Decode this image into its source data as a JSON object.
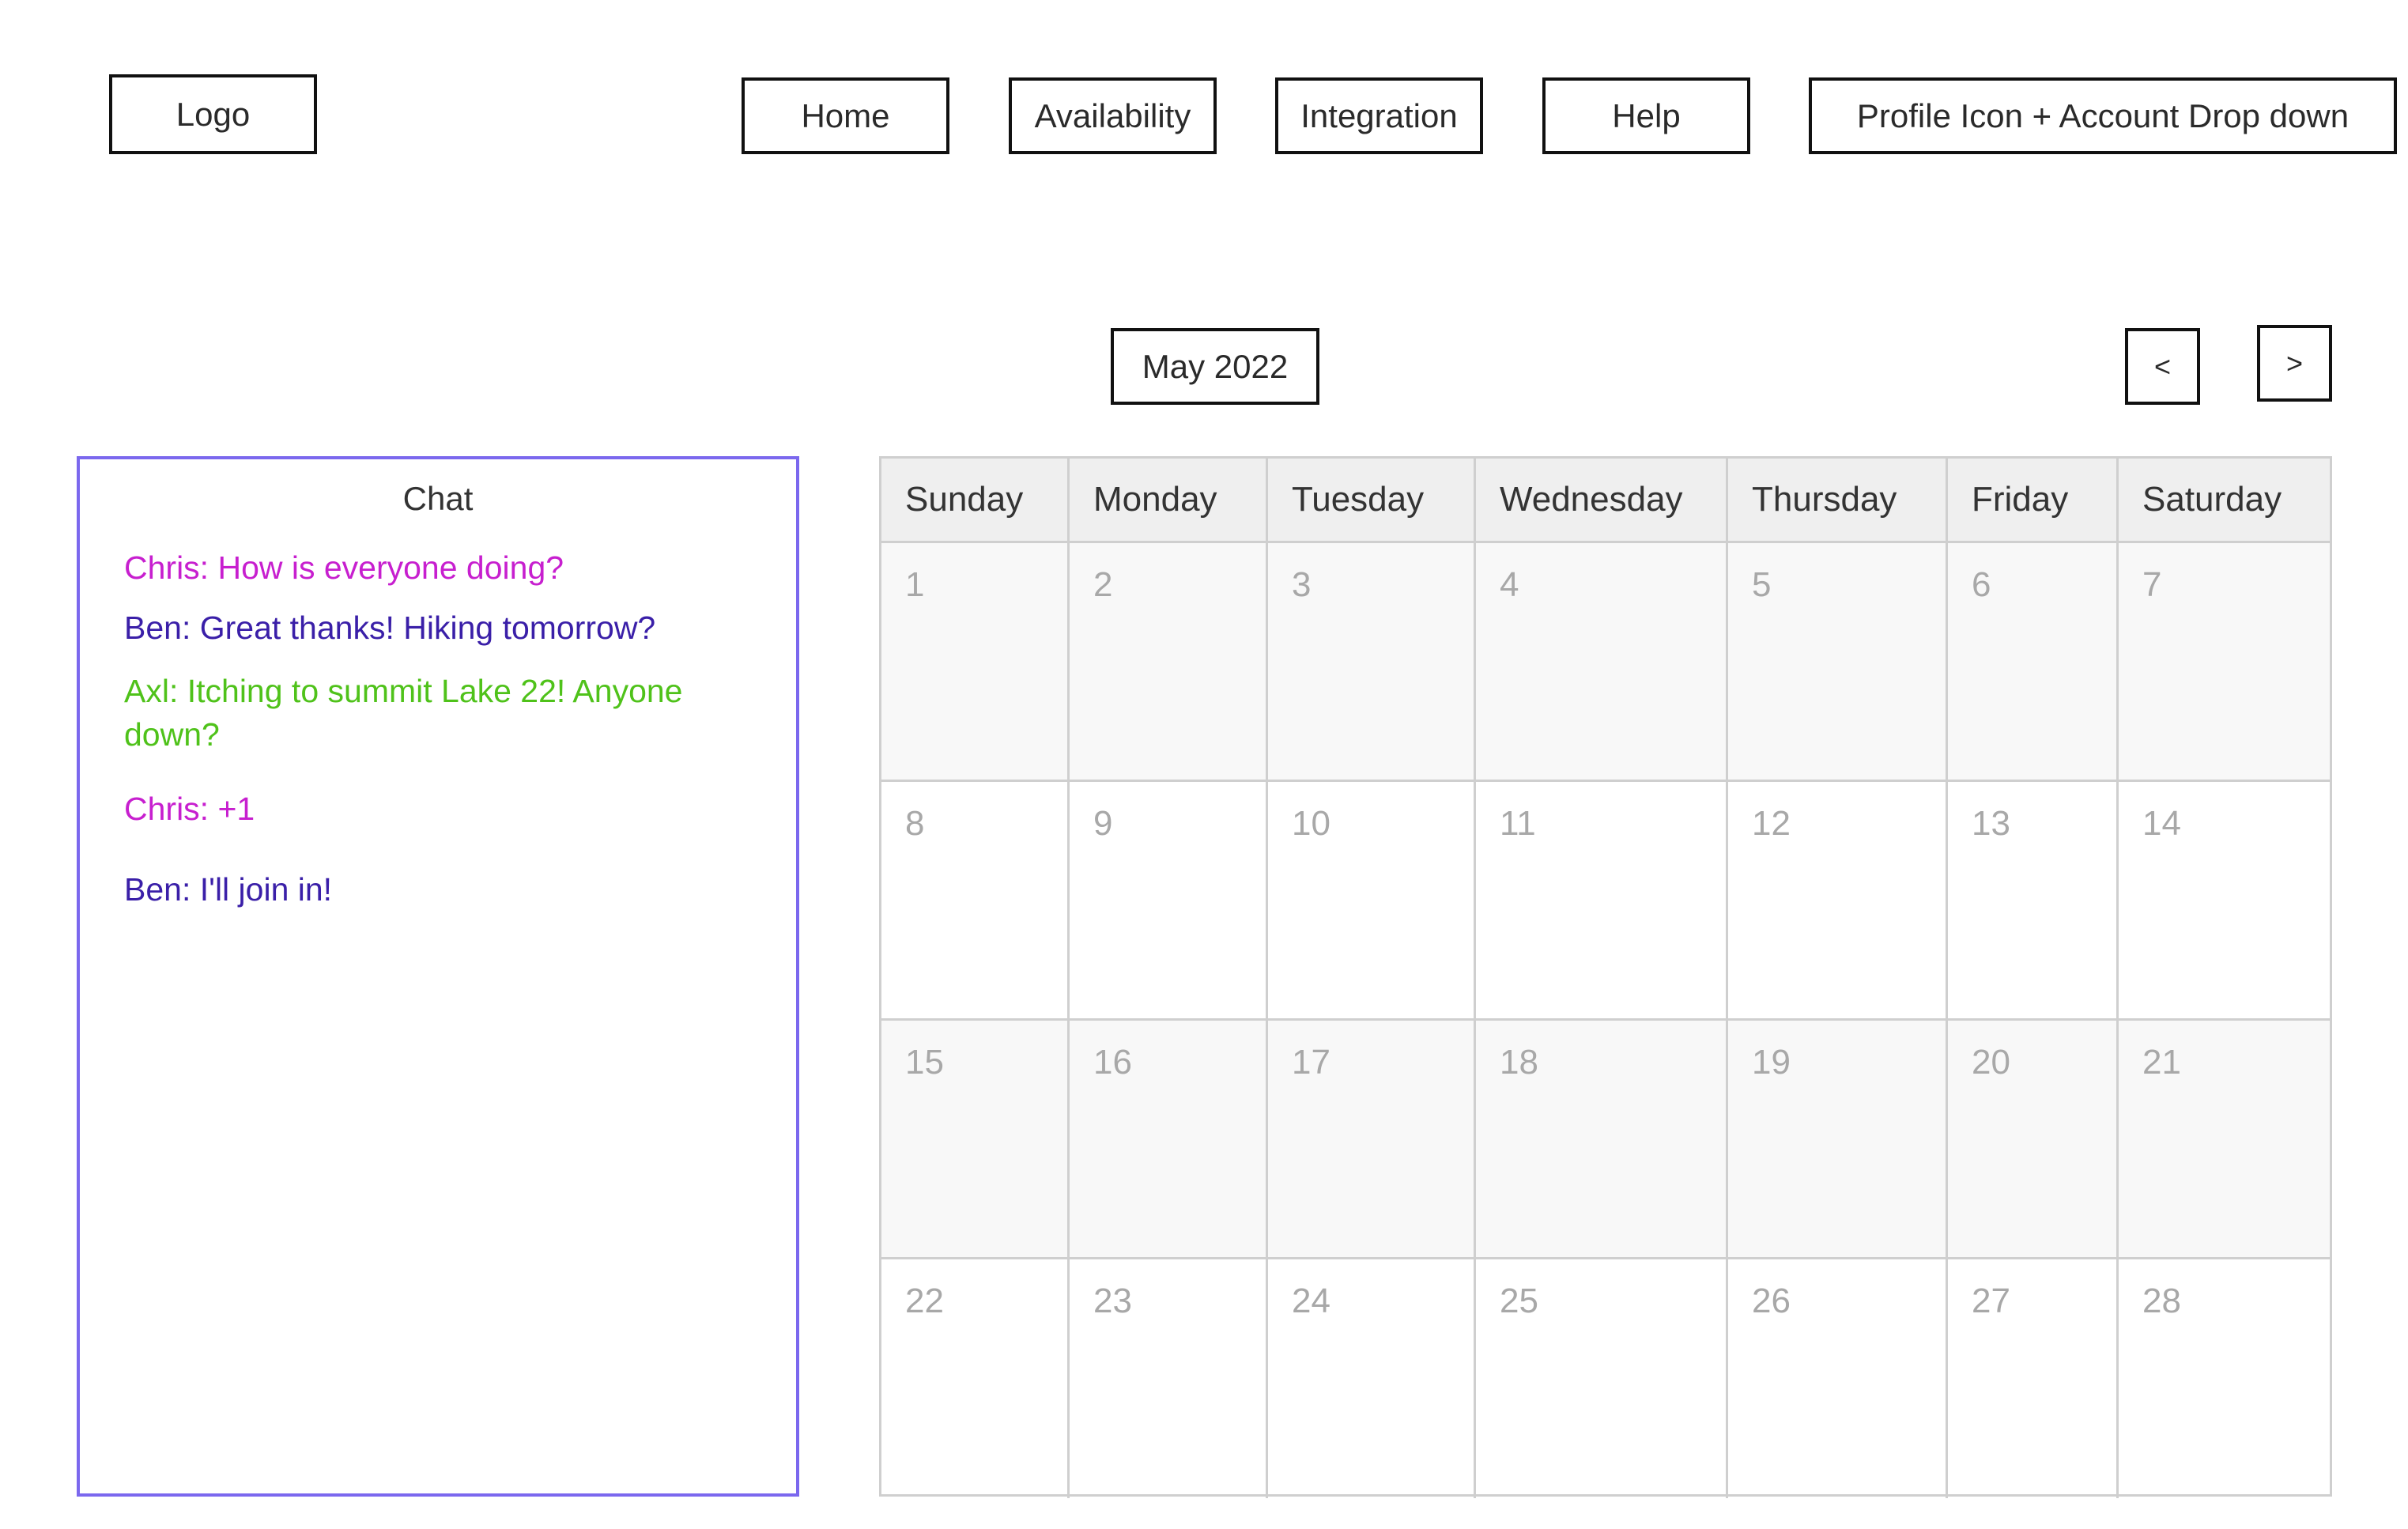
{
  "header": {
    "logo_label": "Logo",
    "nav": {
      "home": "Home",
      "availability": "Availability",
      "integration": "Integration",
      "help": "Help",
      "profile": "Profile Icon + Account Drop down"
    }
  },
  "calendar": {
    "month_label": "May 2022",
    "prev_label": "<",
    "next_label": ">",
    "days": [
      "Sunday",
      "Monday",
      "Tuesday",
      "Wednesday",
      "Thursday",
      "Friday",
      "Saturday"
    ],
    "weeks": [
      [
        "1",
        "2",
        "3",
        "4",
        "5",
        "6",
        "7"
      ],
      [
        "8",
        "9",
        "10",
        "11",
        "12",
        "13",
        "14"
      ],
      [
        "15",
        "16",
        "17",
        "18",
        "19",
        "20",
        "21"
      ],
      [
        "22",
        "23",
        "24",
        "25",
        "26",
        "27",
        "28"
      ]
    ]
  },
  "chat": {
    "title": "Chat",
    "messages": [
      {
        "text": "Chris: How is everyone doing?",
        "color": "#c71fcf"
      },
      {
        "text": "Ben: Great thanks! Hiking tomorrow?",
        "color": "#3a1fa8"
      },
      {
        "text": "Axl: Itching to summit Lake 22! Anyone down?",
        "color": "#4fc21a"
      },
      {
        "text": "Chris: +1",
        "color": "#c71fcf"
      },
      {
        "text": "Ben: I'll join in!",
        "color": "#3a1fa8"
      }
    ]
  },
  "colors": {
    "chat_border": "#7b68ee",
    "grid_line": "#cfcfcf",
    "header_bg": "#efefef",
    "day_number": "#a8a8a8"
  }
}
